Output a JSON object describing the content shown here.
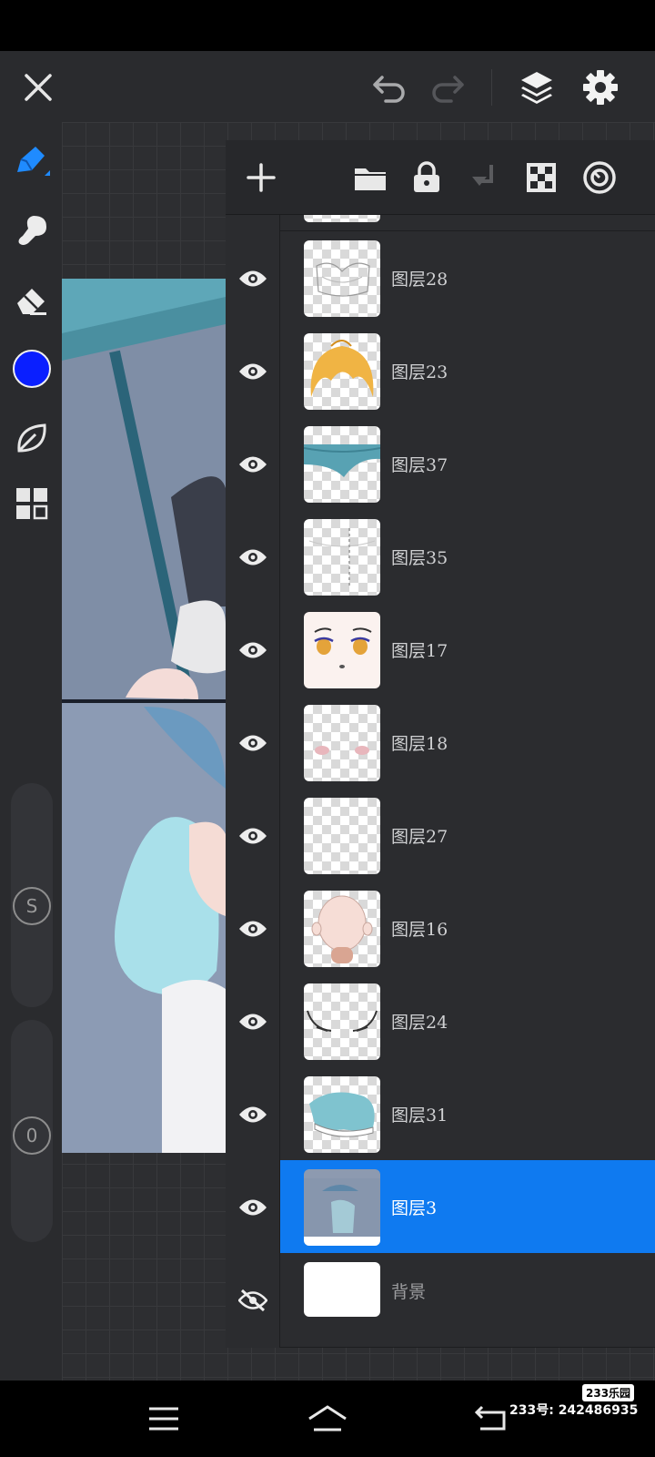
{
  "toolbar": {
    "icons": [
      "close-icon",
      "undo-icon",
      "redo-icon",
      "layers-icon",
      "settings-icon"
    ]
  },
  "tools": {
    "icons": [
      "brush-pen-icon",
      "smudge-icon",
      "eraser-icon",
      "color-swatch",
      "leaf-icon",
      "grid-icon"
    ],
    "current_color": "#0a1fff",
    "size_slider_label": "S",
    "opacity_slider_label": "0"
  },
  "layers_panel": {
    "toolbar_icons": [
      "add-layer-icon",
      "folder-icon",
      "lock-icon",
      "merge-down-icon",
      "transparency-icon",
      "blend-mode-icon"
    ],
    "layers": [
      {
        "name": "图层28",
        "visible": true,
        "selected": false
      },
      {
        "name": "图层23",
        "visible": true,
        "selected": false
      },
      {
        "name": "图层37",
        "visible": true,
        "selected": false
      },
      {
        "name": "图层35",
        "visible": true,
        "selected": false
      },
      {
        "name": "图层17",
        "visible": true,
        "selected": false
      },
      {
        "name": "图层18",
        "visible": true,
        "selected": false
      },
      {
        "name": "图层27",
        "visible": true,
        "selected": false
      },
      {
        "name": "图层16",
        "visible": true,
        "selected": false
      },
      {
        "name": "图层24",
        "visible": true,
        "selected": false
      },
      {
        "name": "图层31",
        "visible": true,
        "selected": false
      },
      {
        "name": "图层3",
        "visible": true,
        "selected": true
      },
      {
        "name": "背景",
        "visible": false,
        "selected": false
      }
    ]
  },
  "nav": {
    "icons": [
      "menu-icon",
      "home-icon",
      "back-icon"
    ]
  },
  "watermark": {
    "logo": "233乐园",
    "text": "233号: 242486935"
  },
  "colors": {
    "accent": "#0f7af0",
    "panel": "#2b2c2f",
    "toolbar": "#2a2b2e"
  }
}
